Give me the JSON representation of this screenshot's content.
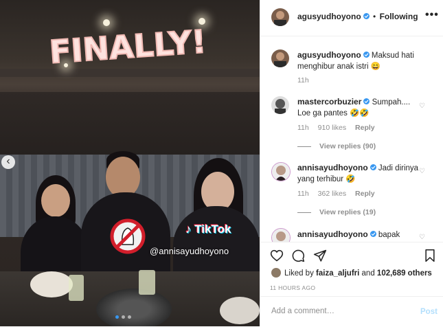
{
  "media": {
    "sticker_text": "FINALLY!",
    "tiktok_label": "TikTok",
    "tiktok_username": "@annisayudhoyono",
    "slide_count": 3,
    "active_slide": 1
  },
  "header": {
    "username": "agusyudhoyono",
    "separator": "•",
    "follow_status": "Following",
    "more_label": "•••"
  },
  "comments": [
    {
      "username": "agusyudhoyono",
      "text": "Maksud hati menghibur anak istri 😄",
      "time": "11h",
      "likes": "",
      "reply": "",
      "view_replies": ""
    },
    {
      "username": "mastercorbuzier",
      "text": "Sumpah.... Loe ga pantes 🤣🤣",
      "time": "11h",
      "likes": "910 likes",
      "reply": "Reply",
      "view_replies": "View replies (90)"
    },
    {
      "username": "annisayudhoyono",
      "text": "Jadi dirinya yang terhibur 🤣",
      "time": "11h",
      "likes": "362 likes",
      "reply": "Reply",
      "view_replies": "View replies (19)"
    },
    {
      "username": "annisayudhoyono",
      "text": "bapak",
      "time": "",
      "likes": "",
      "reply": "",
      "view_replies": ""
    }
  ],
  "actions": {
    "liked_prefix": "Liked by",
    "liked_user": "faiza_aljufri",
    "liked_and": "and",
    "liked_count": "102,689 others",
    "timestamp": "11 HOURS AGO"
  },
  "add_comment": {
    "placeholder": "Add a comment…",
    "post_label": "Post"
  },
  "colors": {
    "verified": "#3897f0",
    "post_disabled": "#b2dffc",
    "secondary_text": "#8e8e8e"
  }
}
